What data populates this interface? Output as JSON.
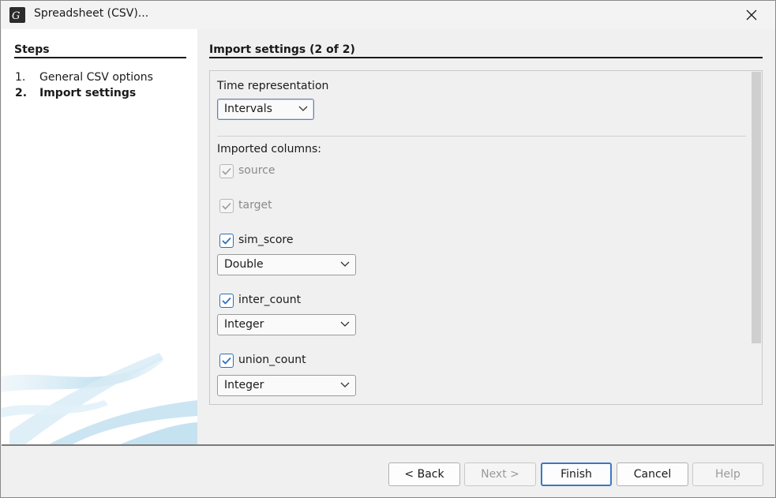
{
  "window": {
    "title": "Spreadsheet (CSV)..."
  },
  "steps": {
    "title": "Steps",
    "items": [
      {
        "num": "1.",
        "label": "General CSV options"
      },
      {
        "num": "2.",
        "label": "Import settings"
      }
    ]
  },
  "import_settings": {
    "title": "Import settings (2 of 2)",
    "time_representation": {
      "label": "Time representation",
      "value": "Intervals"
    },
    "imported_columns_label": "Imported columns:",
    "columns": [
      {
        "name": "source",
        "checked": true,
        "enabled": false
      },
      {
        "name": "target",
        "checked": true,
        "enabled": false
      },
      {
        "name": "sim_score",
        "checked": true,
        "enabled": true,
        "type": "Double"
      },
      {
        "name": "inter_count",
        "checked": true,
        "enabled": true,
        "type": "Integer"
      },
      {
        "name": "union_count",
        "checked": true,
        "enabled": true,
        "type": "Integer"
      }
    ]
  },
  "buttons": {
    "back": "< Back",
    "next": "Next >",
    "finish": "Finish",
    "cancel": "Cancel",
    "help": "Help"
  },
  "colors": {
    "checkbox_accent": "#2f6fb8",
    "default_button_border": "#3a78c2"
  }
}
